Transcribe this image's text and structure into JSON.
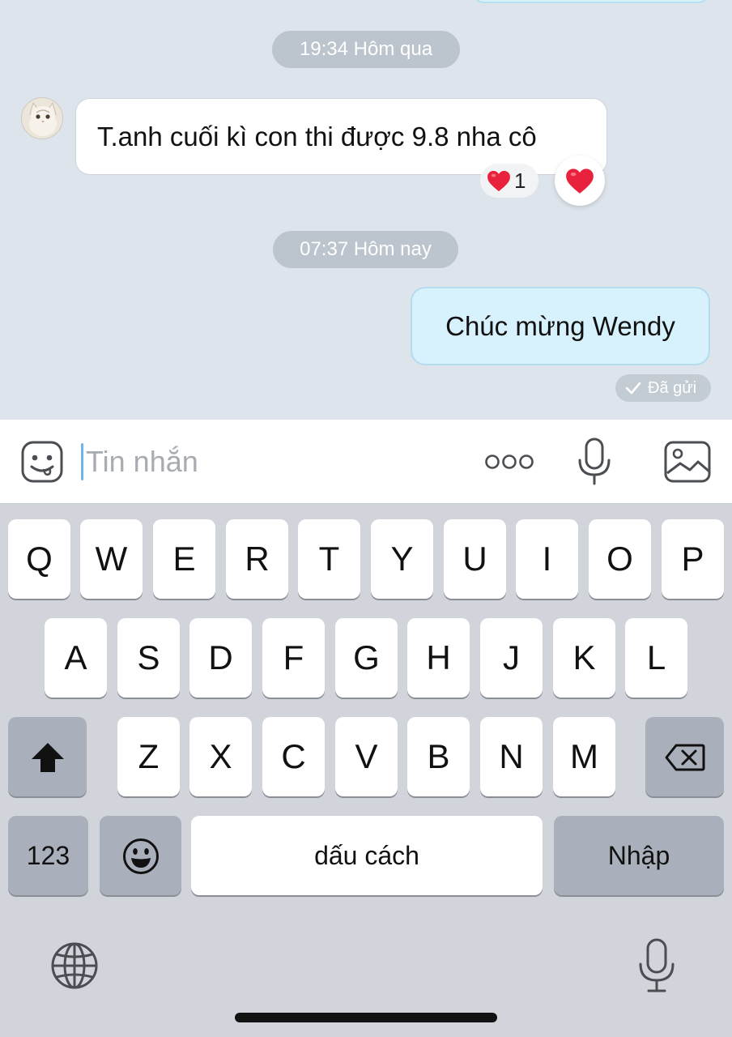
{
  "chat": {
    "time_yesterday": "19:34 Hôm qua",
    "incoming_message": "T.anh cuối kì con thi được 9.8 nha cô",
    "reaction_count": "1",
    "time_today": "07:37 Hôm nay",
    "outgoing_message": "Chúc mừng Wendy",
    "status": "Đã gửi"
  },
  "input": {
    "placeholder": "Tin nhắn",
    "value": ""
  },
  "keyboard": {
    "row1": [
      "Q",
      "W",
      "E",
      "R",
      "T",
      "Y",
      "U",
      "I",
      "O",
      "P"
    ],
    "row2": [
      "A",
      "S",
      "D",
      "F",
      "G",
      "H",
      "J",
      "K",
      "L"
    ],
    "row3": [
      "Z",
      "X",
      "C",
      "V",
      "B",
      "N",
      "M"
    ],
    "numbers_label": "123",
    "space_label": "dấu cách",
    "return_label": "Nhập"
  },
  "icons": {
    "sticker": "sticker-face-icon",
    "more": "more-dots-icon",
    "mic": "microphone-icon",
    "image": "image-gallery-icon",
    "shift": "shift-arrow-icon",
    "backspace": "backspace-icon",
    "emoji": "emoji-icon",
    "globe": "globe-icon",
    "dictation": "dictation-mic-icon"
  },
  "colors": {
    "heart": "#e8213d",
    "outgoing_bubble": "#d7f1fd",
    "caret": "#6db6ea"
  }
}
